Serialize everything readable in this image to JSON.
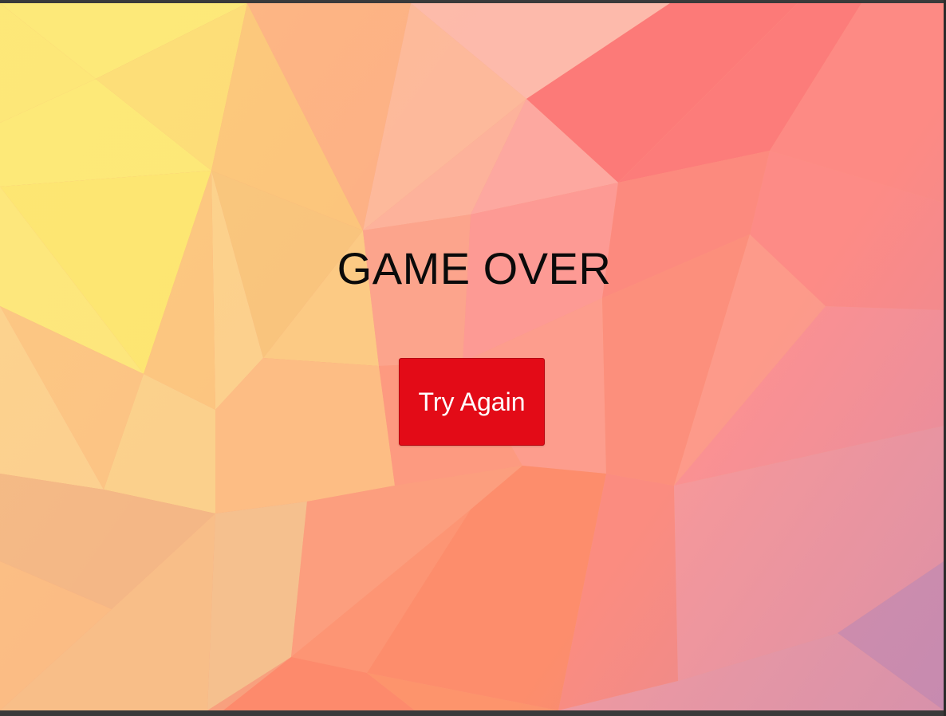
{
  "screen": {
    "title": "GAME OVER",
    "try_again_label": "Try Again"
  },
  "colors": {
    "button": "#e30b17",
    "title_text": "#0a0a0a",
    "button_text": "#ffffff"
  }
}
